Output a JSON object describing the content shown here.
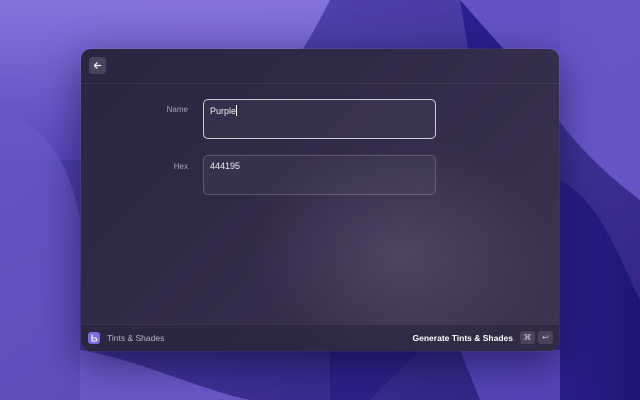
{
  "window": {
    "back_icon": "arrow-left-icon"
  },
  "form": {
    "name_label": "Name",
    "name_value": "Purple",
    "hex_label": "Hex",
    "hex_value": "444195"
  },
  "footer": {
    "app_icon": "tints-shades-icon",
    "app_name": "Tints & Shades",
    "action_label": "Generate Tints & Shades",
    "shortcut_modifier": "⌘",
    "shortcut_key": "↩"
  },
  "colors": {
    "wallpaper": "#3a2e8c",
    "window_bg": "#2b2540",
    "accent": "#7b6fe0"
  }
}
